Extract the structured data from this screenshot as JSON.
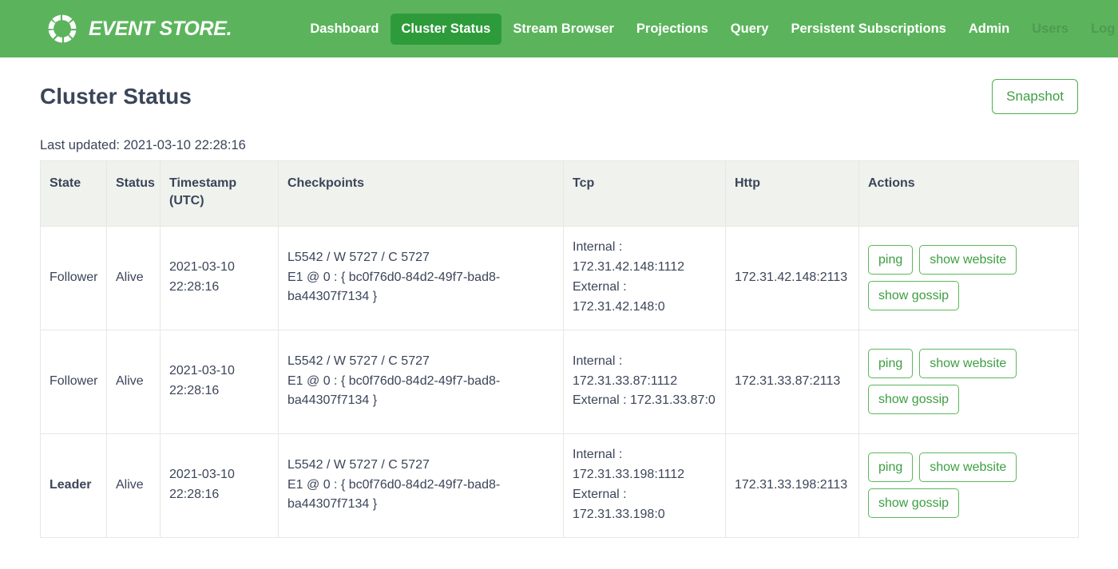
{
  "navbar": {
    "brand": {
      "name": "EVENT STORE.",
      "icon": "eventstore-ring-logo"
    },
    "items": [
      {
        "label": "Dashboard",
        "active": false,
        "muted": false
      },
      {
        "label": "Cluster Status",
        "active": true,
        "muted": false
      },
      {
        "label": "Stream Browser",
        "active": false,
        "muted": false
      },
      {
        "label": "Projections",
        "active": false,
        "muted": false
      },
      {
        "label": "Query",
        "active": false,
        "muted": false
      },
      {
        "label": "Persistent Subscriptions",
        "active": false,
        "muted": false
      },
      {
        "label": "Admin",
        "active": false,
        "muted": false
      },
      {
        "label": "Users",
        "active": false,
        "muted": true
      },
      {
        "label": "Log Out",
        "active": false,
        "muted": true
      }
    ],
    "colors": {
      "background": "#5bb45c",
      "active_background": "#2e9b3b",
      "muted_text": "#4d9a52"
    }
  },
  "page": {
    "title": "Cluster Status",
    "snapshot_button": "Snapshot",
    "last_updated": "Last updated: 2021-03-10 22:28:16"
  },
  "table": {
    "headers": [
      "State",
      "Status",
      "Timestamp (UTC)",
      "Checkpoints",
      "Tcp",
      "Http",
      "Actions"
    ],
    "header_timestamp_line1": "Timestamp",
    "header_timestamp_line2": "(UTC)",
    "rows": [
      {
        "state": "Follower",
        "is_leader": false,
        "status": "Alive",
        "timestamp": "2021-03-10 22:28:16",
        "checkpoints_line1": "L5542 / W 5727 / C 5727",
        "checkpoints_line2": "E1 @ 0 : { bc0f76d0-84d2-49f7-bad8-ba44307f7134 }",
        "tcp_internal": "Internal : 172.31.42.148:1112",
        "tcp_external": "External : 172.31.42.148:0",
        "http": "172.31.42.148:2113",
        "actions": [
          "ping",
          "show website",
          "show gossip"
        ]
      },
      {
        "state": "Follower",
        "is_leader": false,
        "status": "Alive",
        "timestamp": "2021-03-10 22:28:16",
        "checkpoints_line1": "L5542 / W 5727 / C 5727",
        "checkpoints_line2": "E1 @ 0 : { bc0f76d0-84d2-49f7-bad8-ba44307f7134 }",
        "tcp_internal": "Internal : 172.31.33.87:1112",
        "tcp_external": "External : 172.31.33.87:0",
        "http": "172.31.33.87:2113",
        "actions": [
          "ping",
          "show website",
          "show gossip"
        ]
      },
      {
        "state": "Leader",
        "is_leader": true,
        "status": "Alive",
        "timestamp": "2021-03-10 22:28:16",
        "checkpoints_line1": "L5542 / W 5727 / C 5727",
        "checkpoints_line2": "E1 @ 0 : { bc0f76d0-84d2-49f7-bad8-ba44307f7134 }",
        "tcp_internal": "Internal : 172.31.33.198:1112",
        "tcp_external": "External : 172.31.33.198:0",
        "http": "172.31.33.198:2113",
        "actions": [
          "ping",
          "show website",
          "show gossip"
        ]
      }
    ]
  }
}
